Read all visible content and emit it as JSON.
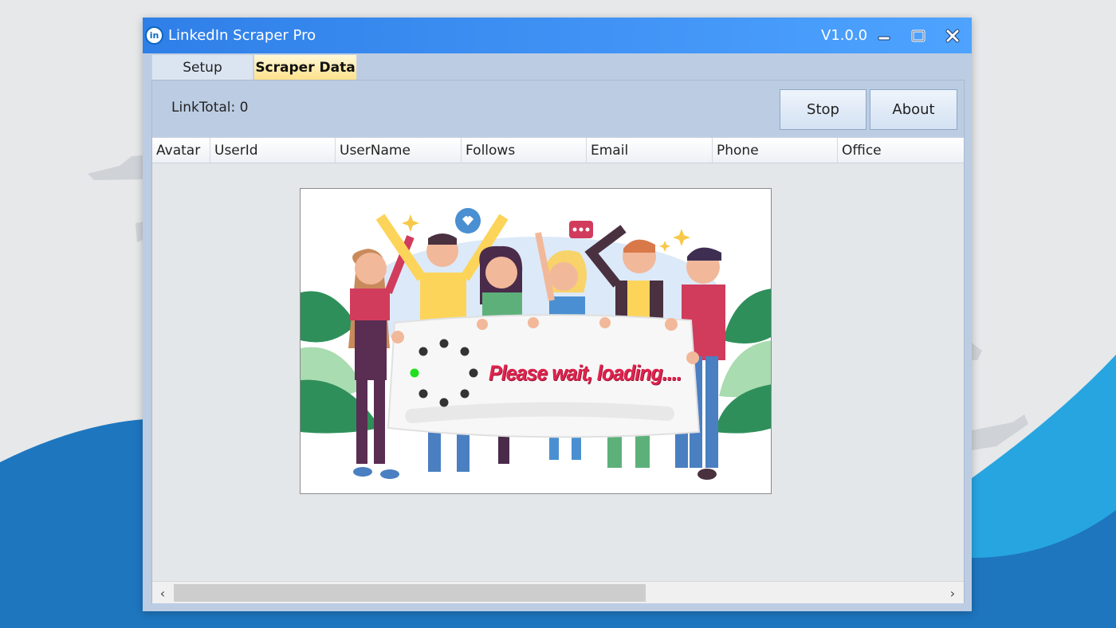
{
  "window": {
    "title": "LinkedIn Scraper Pro",
    "version": "V1.0.0",
    "icon_text": "in"
  },
  "tabs": [
    {
      "label": "Setup",
      "active": false
    },
    {
      "label": "Scraper Data",
      "active": true
    }
  ],
  "toolbar": {
    "link_total": "LinkTotal: 0",
    "stop_label": "Stop",
    "about_label": "About"
  },
  "table": {
    "columns": [
      "Avatar",
      "UserId",
      "UserName",
      "Follows",
      "Email",
      "Phone",
      "Office"
    ],
    "rows": []
  },
  "loading": {
    "text": "Please wait, loading....",
    "active_dot_color": "#1ee01e",
    "dot_color": "#333333",
    "text_color": "#e0234e"
  },
  "colors": {
    "titlebar_start": "#2f7fe8",
    "titlebar_end": "#4ea3ff",
    "panel": "#bccde3",
    "active_tab": "#fde18b"
  }
}
